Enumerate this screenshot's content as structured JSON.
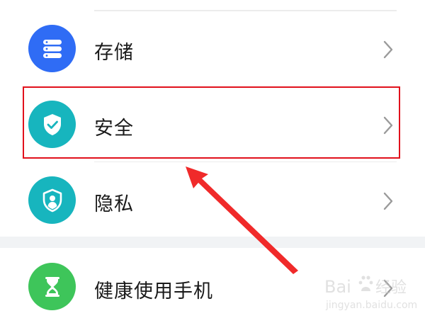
{
  "settings": {
    "items": [
      {
        "label": "存储",
        "icon": "storage-icon",
        "color": "#2f6cf5"
      },
      {
        "label": "安全",
        "icon": "shield-check-icon",
        "color": "#17b5be"
      },
      {
        "label": "隐私",
        "icon": "privacy-shield-icon",
        "color": "#17b5be"
      },
      {
        "label": "健康使用手机",
        "icon": "hourglass-icon",
        "color": "#3ec55a"
      }
    ]
  },
  "annotation": {
    "highlight_color": "#e1111c"
  },
  "watermark": {
    "brand_left": "Bai",
    "brand_right": "经验",
    "url": "jingyan.baidu.com"
  }
}
